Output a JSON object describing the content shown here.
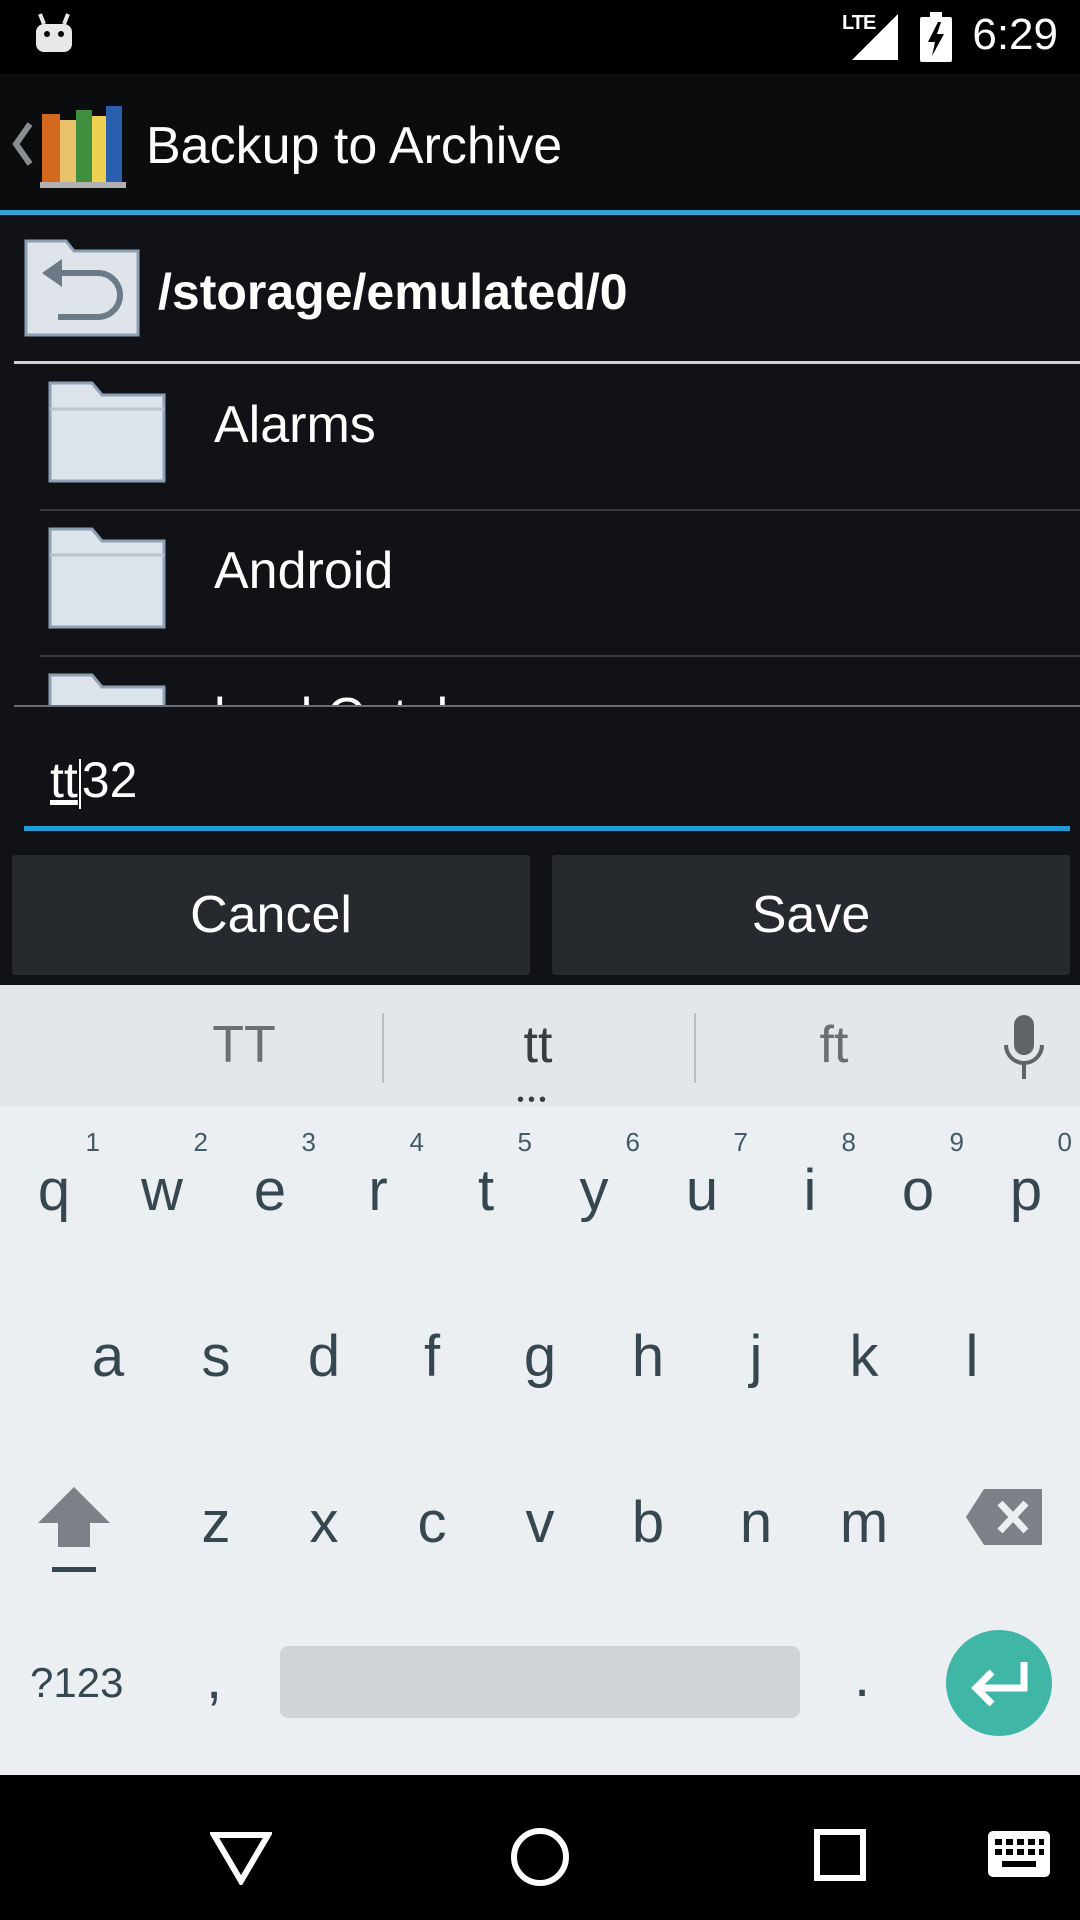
{
  "status_bar": {
    "time": "6:29",
    "network": "LTE",
    "icons": [
      "android-debug-icon",
      "signal-icon",
      "battery-charging-icon"
    ]
  },
  "action_bar": {
    "title": "Backup to Archive",
    "icons": [
      "back-icon",
      "app-books-icon"
    ]
  },
  "file_browser": {
    "current_path": "/storage/emulated/0",
    "items": [
      {
        "name": "Alarms",
        "icon": "folder-icon"
      },
      {
        "name": "Android",
        "icon": "folder-icon"
      },
      {
        "name": "bookCatalogue",
        "icon": "folder-icon"
      }
    ]
  },
  "filename_input": {
    "composing_text": "tt",
    "after_cursor_text": "32"
  },
  "buttons": {
    "cancel": "Cancel",
    "save": "Save"
  },
  "keyboard": {
    "suggestions": [
      "TT",
      "tt",
      "ft"
    ],
    "row1": [
      {
        "key": "q",
        "hint": "1"
      },
      {
        "key": "w",
        "hint": "2"
      },
      {
        "key": "e",
        "hint": "3"
      },
      {
        "key": "r",
        "hint": "4"
      },
      {
        "key": "t",
        "hint": "5"
      },
      {
        "key": "y",
        "hint": "6"
      },
      {
        "key": "u",
        "hint": "7"
      },
      {
        "key": "i",
        "hint": "8"
      },
      {
        "key": "o",
        "hint": "9"
      },
      {
        "key": "p",
        "hint": "0"
      }
    ],
    "row2": [
      "a",
      "s",
      "d",
      "f",
      "g",
      "h",
      "j",
      "k",
      "l"
    ],
    "row3": [
      "z",
      "x",
      "c",
      "v",
      "b",
      "n",
      "m"
    ],
    "symbols_label": "?123",
    "comma": ",",
    "period": "."
  },
  "colors": {
    "accent": "#2fa5d8",
    "enter_key": "#40b6a6",
    "keyboard_bg": "#eceff1"
  }
}
